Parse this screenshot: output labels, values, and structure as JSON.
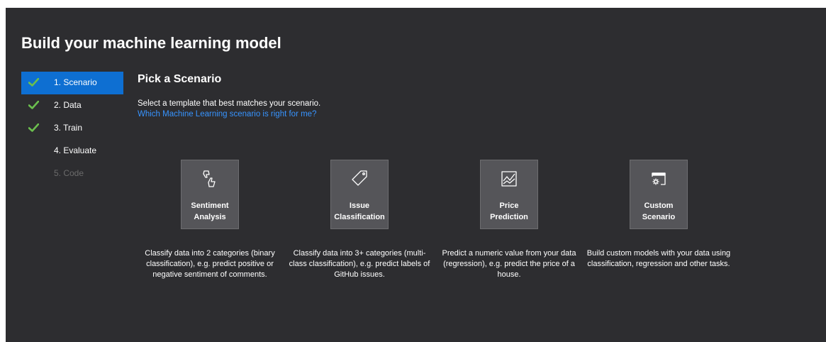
{
  "header": {
    "title": "Build your machine learning model"
  },
  "steps": [
    {
      "label": "1. Scenario",
      "state": "active",
      "checked": true
    },
    {
      "label": "2. Data",
      "state": "done",
      "checked": true
    },
    {
      "label": "3. Train",
      "state": "done",
      "checked": true
    },
    {
      "label": "4. Evaluate",
      "state": "pending",
      "checked": false
    },
    {
      "label": "5. Code",
      "state": "disabled",
      "checked": false
    }
  ],
  "main": {
    "title": "Pick a Scenario",
    "description": "Select a template that best matches your scenario.",
    "help_link": "Which Machine Learning scenario is right for me?",
    "scenarios": [
      {
        "name_line1": "Sentiment",
        "name_line2": "Analysis",
        "icon": "thumbs-feedback-icon",
        "description": "Classify data into 2 categories (binary classification), e.g. predict positive or negative sentiment of comments."
      },
      {
        "name_line1": "Issue",
        "name_line2": "Classification",
        "icon": "tag-icon",
        "description": "Classify data into 3+ categories (multi-class classification), e.g. predict labels of GitHub issues."
      },
      {
        "name_line1": "Price",
        "name_line2": "Prediction",
        "icon": "line-chart-icon",
        "description": "Predict a numeric value from your data (regression), e.g. predict the price of a house."
      },
      {
        "name_line1": "Custom",
        "name_line2": "Scenario",
        "icon": "custom-window-gear-icon",
        "description": "Build custom models with your data using classification, regression and other tasks."
      }
    ]
  },
  "colors": {
    "background": "#2d2d30",
    "accent": "#0e6fd2",
    "check": "#6bbf4e",
    "link": "#3794ff",
    "card": "#555559"
  }
}
